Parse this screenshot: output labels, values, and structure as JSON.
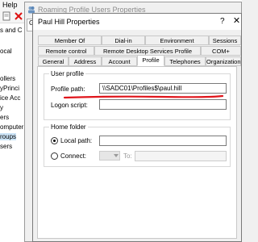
{
  "background": {
    "menu_label": "Help",
    "tree_items": [
      {
        "label": "s and C",
        "selected": false
      },
      {
        "label": "ocal",
        "selected": false
      },
      {
        "label": "ollers",
        "selected": false
      },
      {
        "label": "yPrinci",
        "selected": false
      },
      {
        "label": "ice Acc",
        "selected": false
      },
      {
        "label": "y",
        "selected": false
      },
      {
        "label": "ers",
        "selected": false
      },
      {
        "label": "omputer",
        "selected": false
      },
      {
        "label": "roups",
        "selected": true
      },
      {
        "label": "sers",
        "selected": false
      }
    ]
  },
  "outer_dialog": {
    "title": "Roaming Profile Users Properties",
    "tab_fragment": "Ge"
  },
  "dialog": {
    "title": "Paul Hill Properties",
    "help_glyph": "?",
    "close_glyph": "✕",
    "tabs_row1": [
      "Member Of",
      "Dial-in",
      "Environment",
      "Sessions"
    ],
    "tabs_row2": [
      "Remote control",
      "Remote Desktop Services Profile",
      "COM+"
    ],
    "tabs_row3": [
      "General",
      "Address",
      "Account",
      "Profile",
      "Telephones",
      "Organization"
    ],
    "active_tab": "Profile",
    "user_profile": {
      "group_label": "User profile",
      "profile_path_label": "Profile path:",
      "profile_path_value": "\\\\SADC01\\Profiles$\\paul.hill",
      "logon_script_label": "Logon script:",
      "logon_script_value": ""
    },
    "home_folder": {
      "group_label": "Home folder",
      "local_path_label": "Local path:",
      "local_path_value": "",
      "connect_label": "Connect:",
      "to_label": "To:",
      "selected_option": "Local path"
    }
  },
  "colors": {
    "annotation": "#e0151b",
    "selection": "#cce4f7"
  }
}
